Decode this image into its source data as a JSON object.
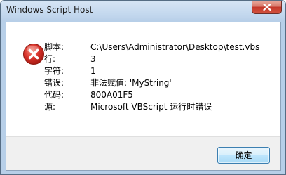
{
  "window": {
    "title": "Windows Script Host"
  },
  "dialog": {
    "icon": "error-icon",
    "rows": [
      {
        "label": "脚本:",
        "value": "C:\\Users\\Administrator\\Desktop\\test.vbs"
      },
      {
        "label": "行:",
        "value": "3"
      },
      {
        "label": "字符:",
        "value": "1"
      },
      {
        "label": "错误:",
        "value": "非法赋值: 'MyString'"
      },
      {
        "label": "代码:",
        "value": "800A01F5"
      },
      {
        "label": "源:",
        "value": "Microsoft VBScript 运行时错误"
      }
    ],
    "ok_label": "确定"
  },
  "colors": {
    "error_red": "#d8322a",
    "close_red": "#c4372a",
    "titlebar": "#c1d6ed",
    "footer": "#f0f0f0"
  }
}
